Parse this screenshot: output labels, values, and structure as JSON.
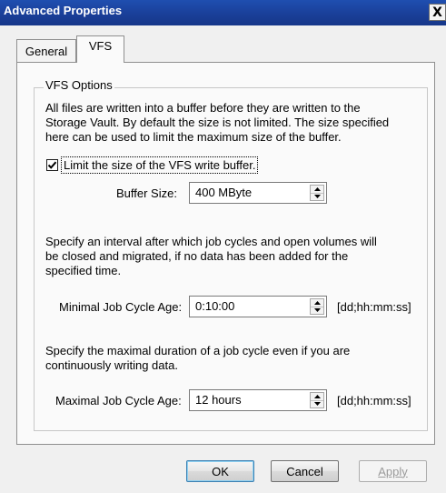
{
  "window": {
    "title": "Advanced Properties",
    "close_label": "X"
  },
  "tabs": [
    {
      "label": "General",
      "selected": false
    },
    {
      "label": "VFS",
      "selected": true
    }
  ],
  "vfs_options": {
    "group_label": "VFS Options",
    "intro_lines": [
      "All files are written into a buffer before they are written to the",
      "Storage Vault. By default the size is not limited. The size specified",
      "here can be used to limit the maximum size of the buffer."
    ],
    "limit_checkbox": {
      "label": "Limit the size of the VFS write buffer.",
      "checked": true
    },
    "buffer_size": {
      "label": "Buffer Size:",
      "value": "400 MByte"
    },
    "interval_lines": [
      "Specify an interval after which job cycles and open volumes will",
      "be closed and migrated, if no data has been added for the",
      "specified time."
    ],
    "min_job_cycle": {
      "label": "Minimal Job Cycle Age:",
      "value": "0:10:00",
      "unit": "[dd;hh:mm:ss]"
    },
    "duration_lines": [
      "Specify the maximal duration of a job cycle even if you are",
      "continuously writing data."
    ],
    "max_job_cycle": {
      "label": "Maximal Job Cycle Age:",
      "value": "12 hours",
      "unit": "[dd;hh:mm:ss]"
    }
  },
  "buttons": {
    "ok": "OK",
    "cancel": "Cancel",
    "apply": "Apply",
    "apply_enabled": false
  },
  "colors": {
    "titlebar": "#1a3f99",
    "window_bg": "#f0f0f0",
    "panel_bg": "#fafafa"
  },
  "icons": {
    "checkbox_check": "check-icon",
    "spin_up": "spin-up-arrow-icon",
    "spin_down": "spin-down-arrow-icon"
  }
}
